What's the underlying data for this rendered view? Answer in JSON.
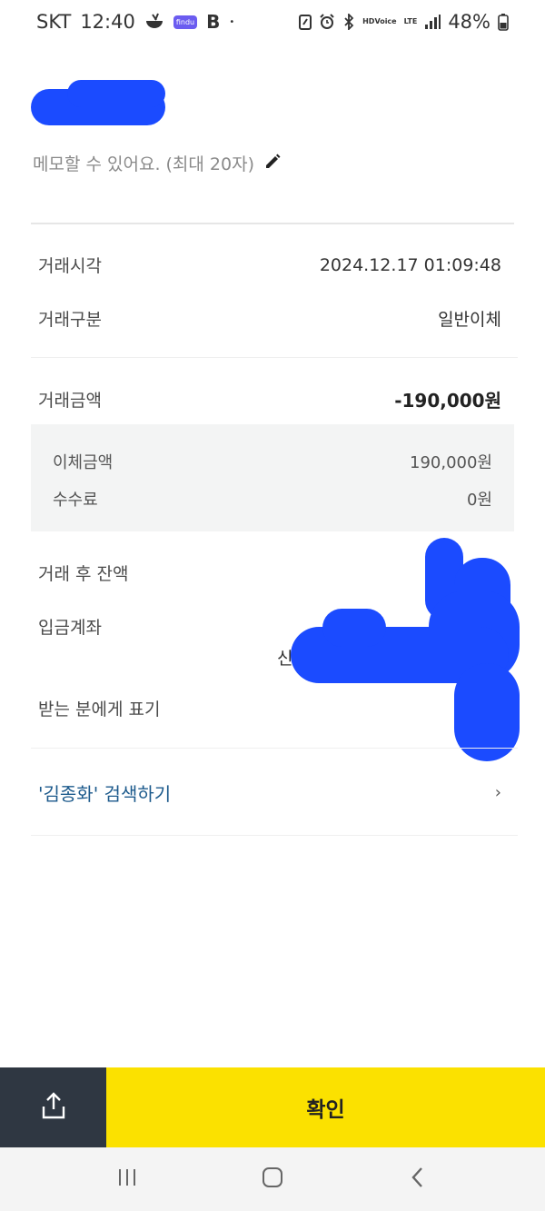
{
  "status_bar": {
    "carrier": "SKT",
    "time": "12:40",
    "findu_label": "findu",
    "b_label": "B",
    "dot": "•",
    "hd_label_top": "HD",
    "hd_label_bottom": "Voice",
    "lte_label": "LTE",
    "battery_percent": "48%"
  },
  "memo": {
    "placeholder": "메모할 수 있어요. (최대 20자)"
  },
  "details": {
    "time_label": "거래시각",
    "time_value": "2024.12.17 01:09:48",
    "type_label": "거래구분",
    "type_value": "일반이체",
    "amount_label": "거래금액",
    "amount_value": "-190,000원",
    "transfer_label": "이체금액",
    "transfer_value": "190,000원",
    "fee_label": "수수료",
    "fee_value": "0원",
    "balance_label": "거래 후 잔액",
    "account_label": "입금계좌",
    "account_partial": "신",
    "recipient_display_label": "받는 분에게 표기"
  },
  "search": {
    "label": "'김종화' 검색하기",
    "chevron": "›"
  },
  "bottom": {
    "confirm_label": "확인"
  },
  "colors": {
    "accent_yellow": "#fbe100",
    "share_bg": "#2f3742",
    "link_blue": "#1c5a8c",
    "redaction_blue": "#1b4bff"
  }
}
